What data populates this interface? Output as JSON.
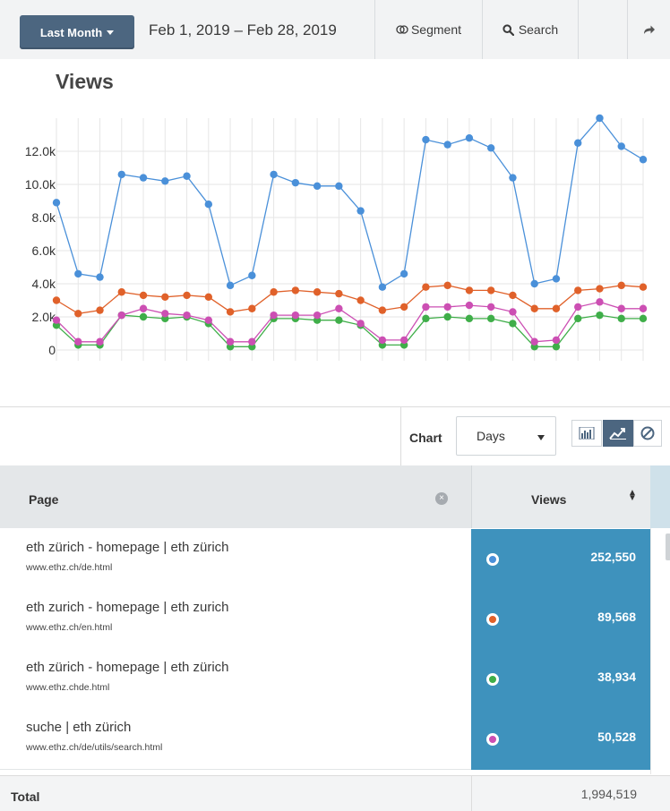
{
  "toolbar": {
    "range_label": "Last Month",
    "date_range": "Feb 1, 2019 – Feb 28, 2019",
    "segment_label": "Segment",
    "search_label": "Search"
  },
  "chart_data": {
    "type": "line",
    "title": "Views",
    "xlabel": "",
    "ylabel": "",
    "x": [
      1,
      2,
      3,
      4,
      5,
      6,
      7,
      8,
      9,
      10,
      11,
      12,
      13,
      14,
      15,
      16,
      17,
      18,
      19,
      20,
      21,
      22,
      23,
      24,
      25,
      26,
      27,
      28
    ],
    "y_ticks": [
      "0",
      "2.0k",
      "4.0k",
      "6.0k",
      "8.0k",
      "10.0k",
      "12.0k"
    ],
    "ylim": [
      0,
      14000
    ],
    "grid": true,
    "series": [
      {
        "color": "#4a90d9",
        "values": [
          8900,
          4600,
          4400,
          10600,
          10400,
          10200,
          10500,
          8800,
          3900,
          4500,
          10600,
          10100,
          9900,
          9900,
          8400,
          3800,
          4600,
          12700,
          12400,
          12800,
          12200,
          10400,
          4000,
          4300,
          12500,
          14000,
          12300,
          11500
        ]
      },
      {
        "color": "#e0612a",
        "values": [
          3000,
          2200,
          2400,
          3500,
          3300,
          3200,
          3300,
          3200,
          2300,
          2500,
          3500,
          3600,
          3500,
          3400,
          3000,
          2400,
          2600,
          3800,
          3900,
          3600,
          3600,
          3300,
          2500,
          2500,
          3600,
          3700,
          3900,
          3800
        ]
      },
      {
        "color": "#cc4fb3",
        "values": [
          1800,
          500,
          500,
          2100,
          2500,
          2200,
          2100,
          1800,
          500,
          500,
          2100,
          2100,
          2100,
          2500,
          1600,
          600,
          600,
          2600,
          2600,
          2700,
          2600,
          2300,
          500,
          600,
          2600,
          2900,
          2500,
          2500
        ]
      },
      {
        "color": "#3fae49",
        "values": [
          1500,
          300,
          300,
          2100,
          2000,
          1900,
          2000,
          1600,
          200,
          200,
          1900,
          1900,
          1800,
          1800,
          1500,
          300,
          300,
          1900,
          2000,
          1900,
          1900,
          1600,
          200,
          200,
          1900,
          2100,
          1900,
          1900
        ]
      }
    ]
  },
  "controls": {
    "chart_label": "Chart",
    "granularity": "Days"
  },
  "table": {
    "col_page": "Page",
    "col_views": "Views",
    "rows": [
      {
        "title": "eth zürich - homepage | eth zürich",
        "url": "www.ethz.ch/de.html",
        "views": "252,550",
        "color": "#4a90d9"
      },
      {
        "title": "eth zurich - homepage | eth zurich",
        "url": "www.ethz.ch/en.html",
        "views": "89,568",
        "color": "#e0612a"
      },
      {
        "title": "eth zürich - homepage | eth zürich",
        "url": "www.ethz.chde.html",
        "views": "38,934",
        "color": "#3fae49"
      },
      {
        "title": "suche | eth zürich",
        "url": "www.ethz.ch/de/utils/search.html",
        "views": "50,528",
        "color": "#cc4fb3"
      }
    ],
    "total_label": "Total",
    "total_value": "1,994,519"
  }
}
